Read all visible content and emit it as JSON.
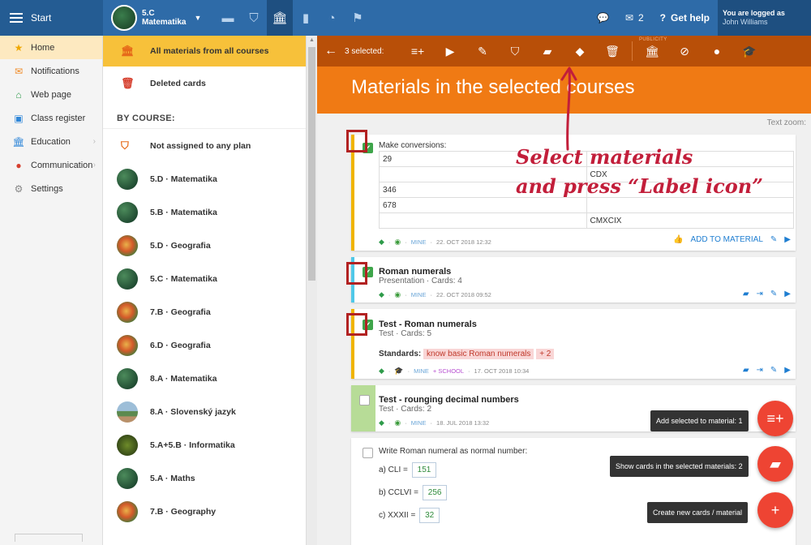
{
  "topbar": {
    "start_label": "Start",
    "course_code": "5.C",
    "course_name": "Matematika",
    "messages_count": "2",
    "help_label": "Get help",
    "logged_label": "You are logged as",
    "user_name": "John Williams"
  },
  "leftnav": {
    "items": [
      {
        "label": "Home"
      },
      {
        "label": "Notifications"
      },
      {
        "label": "Web page"
      },
      {
        "label": "Class register"
      },
      {
        "label": "Education"
      },
      {
        "label": "Communication"
      },
      {
        "label": "Settings"
      }
    ]
  },
  "materials_panel": {
    "all_materials": "All materials from all courses",
    "deleted_cards": "Deleted cards",
    "by_course_header": "BY COURSE:",
    "not_assigned": "Not assigned to any plan",
    "courses": [
      {
        "label": "5.D · Matematika"
      },
      {
        "label": "5.B · Matematika"
      },
      {
        "label": "5.D · Geografia"
      },
      {
        "label": "5.C · Matematika"
      },
      {
        "label": "7.B · Geografia"
      },
      {
        "label": "6.D · Geografia"
      },
      {
        "label": "8.A · Matematika"
      },
      {
        "label": "8.A · Slovenský jazyk"
      },
      {
        "label": "5.A+5.B · Informatika"
      },
      {
        "label": "5.A · Maths"
      },
      {
        "label": "7.B · Geography"
      }
    ]
  },
  "actionbar": {
    "selected_label": "3 selected:",
    "publicity_label": "PUBLICITY"
  },
  "banner": {
    "title": "Materials in the selected courses",
    "text_zoom": "Text zoom:"
  },
  "cards": {
    "conversions": {
      "title": "Make conversions:",
      "rows": [
        [
          "29",
          ""
        ],
        [
          "",
          "CDX"
        ],
        [
          "346",
          ""
        ],
        [
          "678",
          ""
        ],
        [
          "",
          "CMXCIX"
        ]
      ],
      "meta_mine": "MINE",
      "meta_date": "22. OCT 2018 12:32",
      "add_to_material": "ADD TO MATERIAL"
    },
    "roman": {
      "title": "Roman numerals",
      "sub": "Presentation · Cards: 4",
      "meta_mine": "MINE",
      "meta_date": "22. OCT 2018 09:52"
    },
    "test_roman": {
      "title": "Test - Roman numerals",
      "sub": "Test · Cards: 5",
      "standards_label": "Standards:",
      "standard_tag": "know basic Roman numerals",
      "standard_more": "+ 2",
      "meta_mine": "MINE",
      "meta_school": "+ SCHOOL",
      "meta_date": "17. OCT 2018 10:34"
    },
    "test_decimal": {
      "title": "Test - rounging decimal numbers",
      "sub": "Test · Cards: 2",
      "meta_mine": "MINE",
      "meta_date": "18. JUL 2018 13:32"
    },
    "write_roman": {
      "title": "Write Roman numeral as normal number:",
      "a_label": "a) CLI =",
      "a_value": "151",
      "b_label": "b) CCLVI =",
      "b_value": "256",
      "c_label": "c) XXXII =",
      "c_value": "32"
    }
  },
  "tooltips": {
    "add_selected": "Add selected to material: 1",
    "show_cards": "Show cards in the selected materials: 2",
    "create_new": "Create new cards / material"
  },
  "annotation": {
    "line1": "Select materials",
    "line2": "and press “Label icon”"
  },
  "colors": {
    "topbar": "#2e6ba8",
    "actionbar": "#b84f08",
    "banner": "#f07a14",
    "selected_item": "#f7c13a",
    "fab": "#ee4433",
    "annotation": "#c21e3a"
  }
}
